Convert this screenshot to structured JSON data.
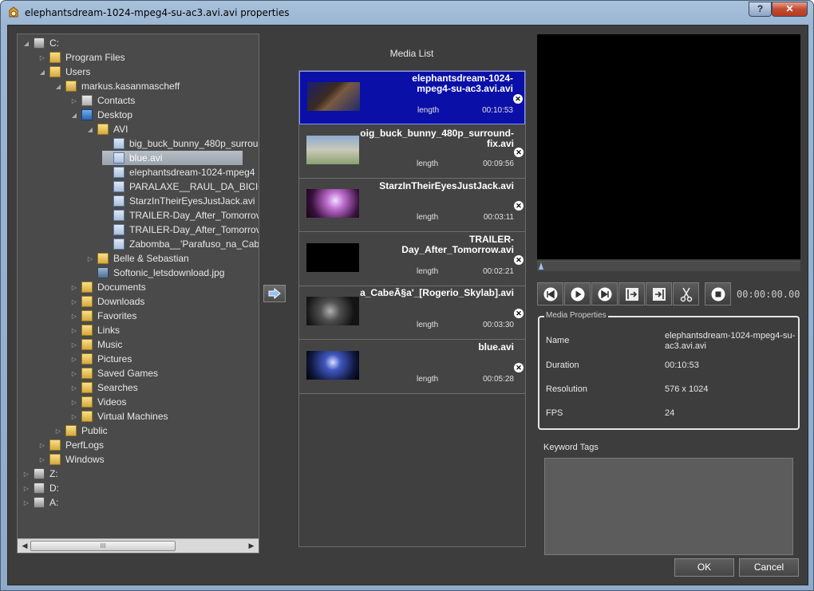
{
  "window": {
    "title": "elephantsdream-1024-mpeg4-su-ac3.avi.avi properties",
    "help": "?",
    "close": "✕"
  },
  "tree": {
    "nodes": [
      {
        "label": "C:",
        "icon": "drive-icon",
        "expanded": true
      },
      {
        "label": "Program Files",
        "icon": "folder-icon"
      },
      {
        "label": "Users",
        "icon": "folder-icon",
        "expanded": true
      },
      {
        "label": "markus.kasanmascheff",
        "icon": "user-folder-icon",
        "expanded": true
      },
      {
        "label": "Contacts",
        "icon": "contacts-icon"
      },
      {
        "label": "Desktop",
        "icon": "desktop-icon",
        "expanded": true
      },
      {
        "label": "AVI",
        "icon": "folder-icon",
        "expanded": true
      },
      {
        "label": "big_buck_bunny_480p_surrou",
        "icon": "video-file-icon"
      },
      {
        "label": "blue.avi",
        "icon": "video-file-icon",
        "selected": true
      },
      {
        "label": "elephantsdream-1024-mpeg4",
        "icon": "video-file-icon"
      },
      {
        "label": "PARALAXE__RAUL_DA_BICIC",
        "icon": "video-file-icon"
      },
      {
        "label": "StarzInTheirEyesJustJack.avi",
        "icon": "video-file-icon"
      },
      {
        "label": "TRAILER-Day_After_Tomorrov",
        "icon": "video-file-icon"
      },
      {
        "label": "TRAILER-Day_After_Tomorrov",
        "icon": "video-file-icon"
      },
      {
        "label": "Zabomba__'Parafuso_na_Cab",
        "icon": "video-file-icon"
      },
      {
        "label": "Belle & Sebastian",
        "icon": "folder-icon"
      },
      {
        "label": "Softonic_letsdownload.jpg",
        "icon": "image-file-icon"
      },
      {
        "label": "Documents",
        "icon": "folder-icon"
      },
      {
        "label": "Downloads",
        "icon": "folder-icon"
      },
      {
        "label": "Favorites",
        "icon": "folder-icon"
      },
      {
        "label": "Links",
        "icon": "folder-icon"
      },
      {
        "label": "Music",
        "icon": "folder-icon"
      },
      {
        "label": "Pictures",
        "icon": "folder-icon"
      },
      {
        "label": "Saved Games",
        "icon": "folder-icon"
      },
      {
        "label": "Searches",
        "icon": "folder-icon"
      },
      {
        "label": "Videos",
        "icon": "folder-icon"
      },
      {
        "label": "Virtual Machines",
        "icon": "folder-icon"
      },
      {
        "label": "Public",
        "icon": "folder-icon"
      },
      {
        "label": "PerfLogs",
        "icon": "folder-icon"
      },
      {
        "label": "Windows",
        "icon": "folder-icon"
      },
      {
        "label": "Z:",
        "icon": "drive-icon"
      },
      {
        "label": "D:",
        "icon": "drive-icon"
      },
      {
        "label": "A:",
        "icon": "drive-icon"
      }
    ],
    "scroll_thumb": "III"
  },
  "media_list": {
    "label": "Media List",
    "items": [
      {
        "title": "elephantsdream-1024-\nmpeg4-su-ac3.avi.avi",
        "length_label": "length",
        "length": "00:10:53",
        "selected": true
      },
      {
        "title": "oig_buck_bunny_480p_surround-\nfix.avi",
        "length_label": "length",
        "length": "00:09:56"
      },
      {
        "title": "StarzInTheirEyesJustJack.avi",
        "length_label": "length",
        "length": "00:03:11"
      },
      {
        "title": "TRAILER-\nDay_After_Tomorrow.avi",
        "length_label": "length",
        "length": "00:02:21"
      },
      {
        "title": "a_CabeÃ§a'_[Rogerio_Skylab].avi",
        "length_label": "length",
        "length": "00:03:30"
      },
      {
        "title": "blue.avi",
        "length_label": "length",
        "length": "00:05:28"
      }
    ]
  },
  "player": {
    "timecode": "00:00:00.00"
  },
  "properties": {
    "legend": "Media Properties",
    "rows": [
      {
        "label": "Name",
        "value": "elephantsdream-1024-mpeg4-su-ac3.avi.avi"
      },
      {
        "label": "Duration",
        "value": "00:10:53"
      },
      {
        "label": "Resolution",
        "value": "576 x 1024"
      },
      {
        "label": "FPS",
        "value": "24"
      }
    ]
  },
  "keywords": {
    "label": "Keyword Tags"
  },
  "buttons": {
    "ok": "OK",
    "cancel": "Cancel"
  },
  "colors": {
    "selection": "#0a0fa8",
    "panel": "#3d3d3d",
    "accent": "#9cc3f0"
  }
}
